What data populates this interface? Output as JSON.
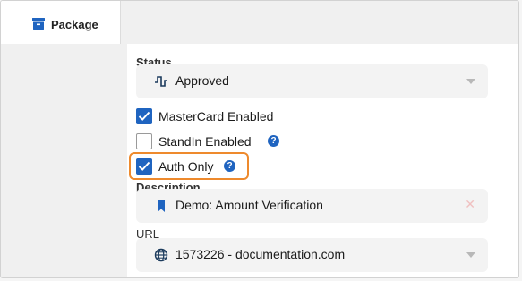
{
  "tab": {
    "label": "Package",
    "icon": "package-icon"
  },
  "status": {
    "label": "Status",
    "value": "Approved",
    "icon": "pulse-icon"
  },
  "checkboxes": [
    {
      "label": "MasterCard Enabled",
      "checked": true,
      "help": false
    },
    {
      "label": "StandIn Enabled",
      "checked": false,
      "help": true
    },
    {
      "label": "Auth Only",
      "checked": true,
      "help": true,
      "highlighted": true
    }
  ],
  "description": {
    "label": "Description",
    "value": "Demo: Amount Verification",
    "icon": "bookmark-icon"
  },
  "url": {
    "label": "URL",
    "value": "1573226 - documentation.com",
    "icon": "globe-icon"
  },
  "colors": {
    "accent": "#1f64c0",
    "highlight": "#ee8a2d"
  }
}
